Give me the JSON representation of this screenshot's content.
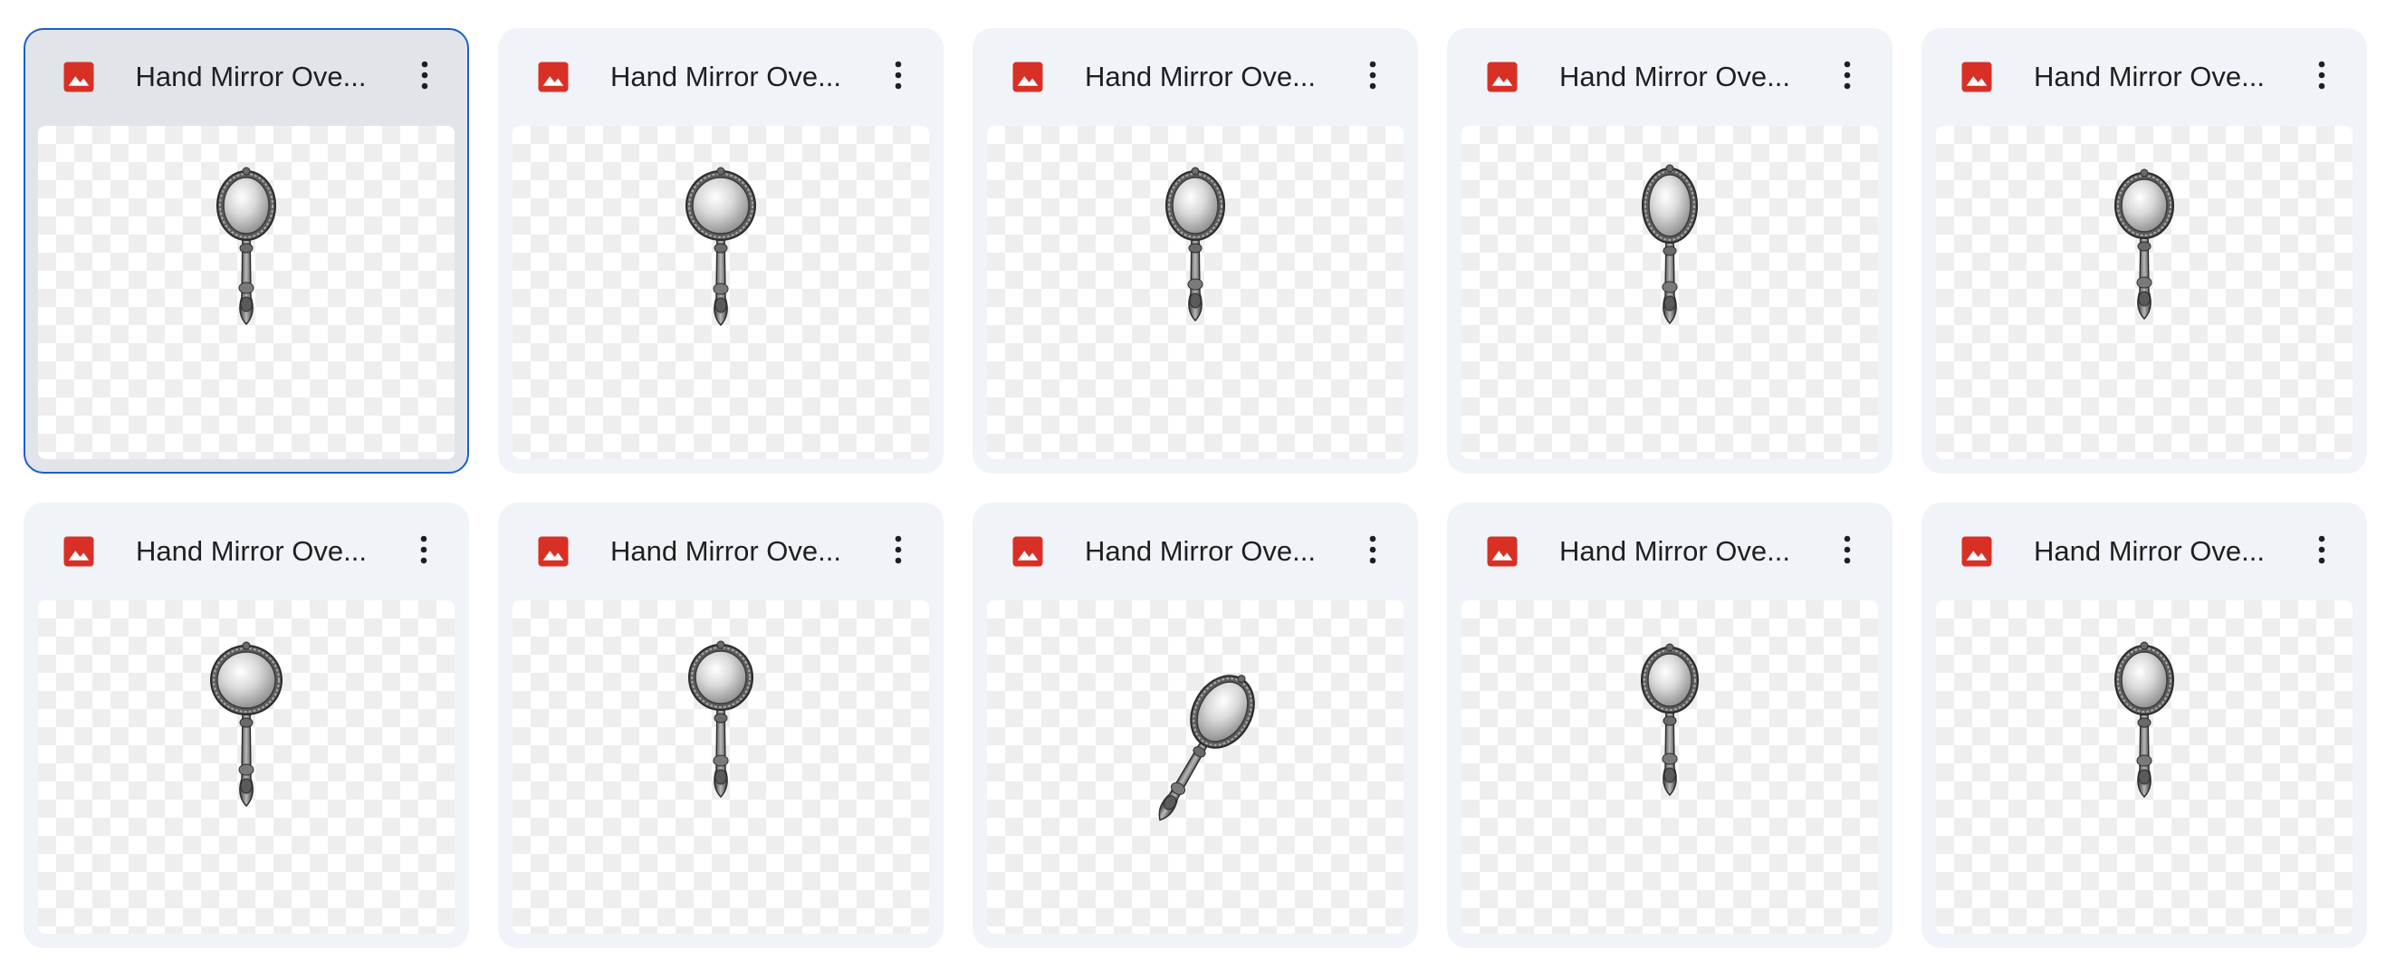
{
  "files": [
    {
      "name": "Hand Mirror Ove...",
      "type_icon": "image-file-icon",
      "variant": "oval-ornate",
      "selected": true
    },
    {
      "name": "Hand Mirror Ove...",
      "type_icon": "image-file-icon",
      "variant": "round-ornate",
      "selected": false
    },
    {
      "name": "Hand Mirror Ove...",
      "type_icon": "image-file-icon",
      "variant": "oval-filigree",
      "selected": false
    },
    {
      "name": "Hand Mirror Ove...",
      "type_icon": "image-file-icon",
      "variant": "teardrop-dark",
      "selected": false
    },
    {
      "name": "Hand Mirror Ove...",
      "type_icon": "image-file-icon",
      "variant": "oval-plain",
      "selected": false
    },
    {
      "name": "Hand Mirror Ove...",
      "type_icon": "image-file-icon",
      "variant": "round-large",
      "selected": false
    },
    {
      "name": "Hand Mirror Ove...",
      "type_icon": "image-file-icon",
      "variant": "round-scalloped",
      "selected": false
    },
    {
      "name": "Hand Mirror Ove...",
      "type_icon": "image-file-icon",
      "variant": "tilted",
      "selected": false
    },
    {
      "name": "Hand Mirror Ove...",
      "type_icon": "image-file-icon",
      "variant": "heart",
      "selected": false
    },
    {
      "name": "Hand Mirror Ove...",
      "type_icon": "image-file-icon",
      "variant": "oval-ornate-small",
      "selected": false
    }
  ],
  "colors": {
    "card_bg": "#f0f4f9",
    "selected_bg": "#e1e5ea",
    "selected_border": "#1d5fc6",
    "image_icon": "#d93025",
    "text": "#1f1f1f"
  },
  "more_icon": "more-vert-icon"
}
